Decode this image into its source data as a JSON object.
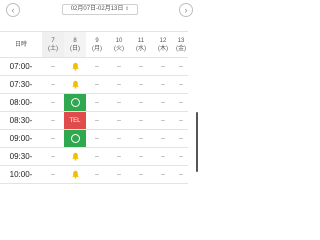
{
  "nav": {
    "prev_icon": "chevron-left-icon",
    "next_icon": "chevron-right-icon",
    "range_label": "02月07日-02月13日",
    "range_caret": "⌃⌄"
  },
  "header": {
    "time_label": "日時",
    "days": [
      {
        "date": "7",
        "dow": "(土)",
        "type": "sat"
      },
      {
        "date": "8",
        "dow": "(日)",
        "type": "sun"
      },
      {
        "date": "9",
        "dow": "(月)",
        "type": "weekday"
      },
      {
        "date": "10",
        "dow": "(火)",
        "type": "weekday"
      },
      {
        "date": "11",
        "dow": "(水)",
        "type": "holiday"
      },
      {
        "date": "12",
        "dow": "(木)",
        "type": "weekday"
      },
      {
        "date": "13",
        "dow": "(金)",
        "type": "weekday"
      }
    ]
  },
  "rows": [
    {
      "time": "07:00-",
      "cells": [
        "–",
        "bell",
        "–",
        "–",
        "–",
        "–",
        "–"
      ]
    },
    {
      "time": "07:30-",
      "cells": [
        "–",
        "bell",
        "–",
        "–",
        "–",
        "–",
        "–"
      ]
    },
    {
      "time": "08:00-",
      "cells": [
        "–",
        "circle",
        "–",
        "–",
        "–",
        "–",
        "–"
      ]
    },
    {
      "time": "08:30-",
      "cells": [
        "–",
        "TEL",
        "–",
        "–",
        "–",
        "–",
        "–"
      ]
    },
    {
      "time": "09:00-",
      "cells": [
        "–",
        "circle",
        "–",
        "–",
        "–",
        "–",
        "–"
      ]
    },
    {
      "time": "09:30-",
      "cells": [
        "–",
        "bell",
        "–",
        "–",
        "–",
        "–",
        "–"
      ]
    },
    {
      "time": "10:00-",
      "cells": [
        "–",
        "bell",
        "–",
        "–",
        "–",
        "–",
        "–"
      ]
    }
  ],
  "colors": {
    "available": "#2fa84f",
    "tel": "#e04b4b",
    "bell": "#f0c000",
    "sunday_text": "#e05050",
    "saturday_bg": "#f0f0f0"
  }
}
